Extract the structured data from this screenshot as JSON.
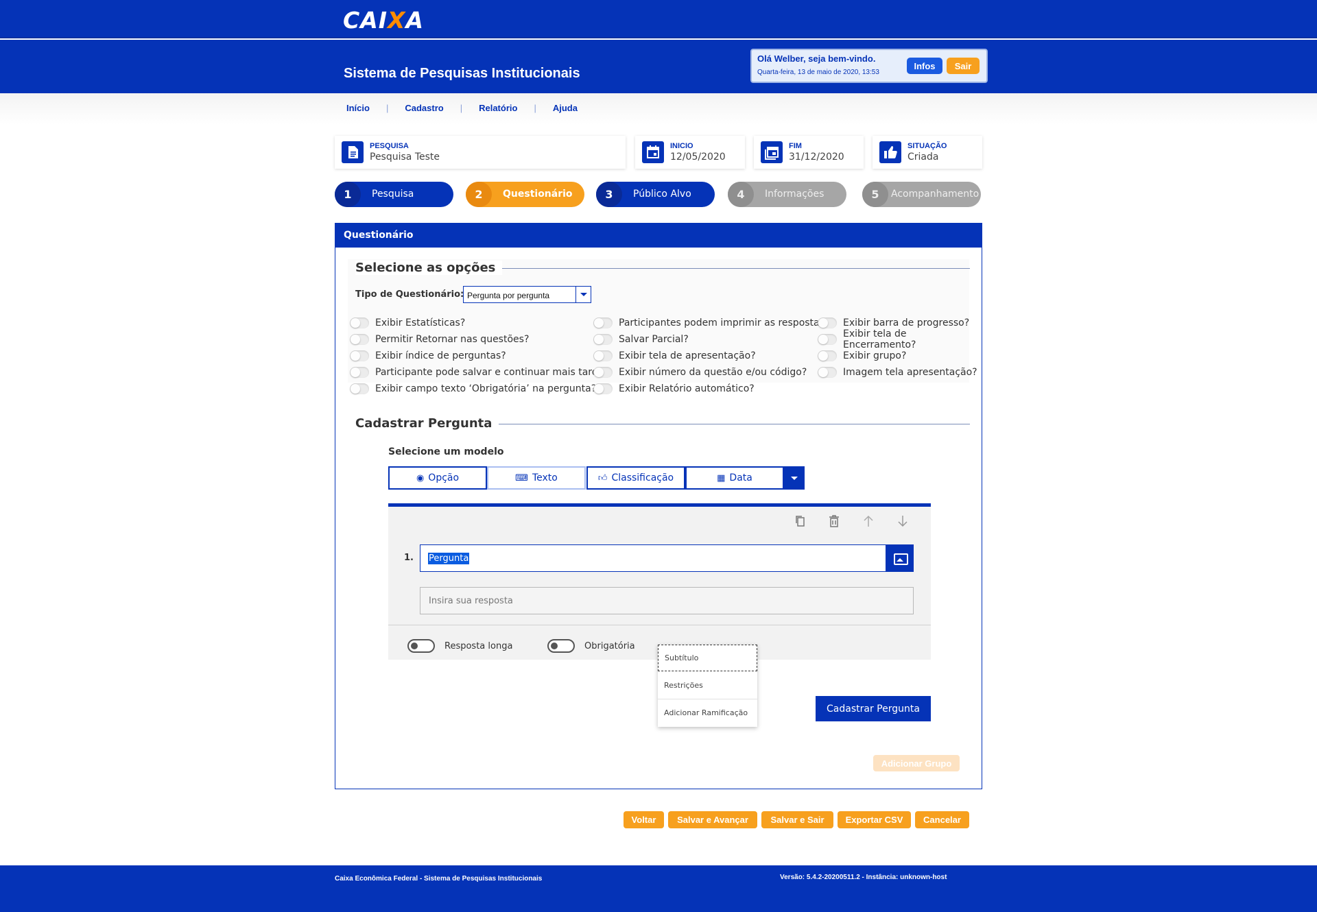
{
  "header": {
    "logo_main": "CAI",
    "logo_x": "X",
    "logo_end": "A",
    "system_title": "Sistema de Pesquisas Institucionais",
    "welcome": "Olá Welber, seja bem-vindo.",
    "datetime": "Quarta-feira, 13 de maio de 2020, 13:53",
    "infos_label": "Infos",
    "sair_label": "Sair"
  },
  "nav": {
    "items": [
      "Início",
      "Cadastro",
      "Relatório",
      "Ajuda"
    ],
    "separator": "|"
  },
  "info_cards": {
    "pesquisa": {
      "label": "PESQUISA",
      "value": "Pesquisa Teste",
      "icon": "document-icon"
    },
    "inicio": {
      "label": "INICIO",
      "value": "12/05/2020",
      "icon": "calendar-icon"
    },
    "fim": {
      "label": "FIM",
      "value": "31/12/2020",
      "icon": "calendar-range-icon"
    },
    "situacao": {
      "label": "SITUAÇÃO",
      "value": "Criada",
      "icon": "thumbs-up-icon"
    }
  },
  "steps": [
    {
      "num": "1",
      "label": "Pesquisa",
      "state": "done"
    },
    {
      "num": "2",
      "label": "Questionário",
      "state": "active"
    },
    {
      "num": "3",
      "label": "Público Alvo",
      "state": "done"
    },
    {
      "num": "4",
      "label": "Informações",
      "state": "disabled"
    },
    {
      "num": "5",
      "label": "Acompanhamento",
      "state": "disabled"
    }
  ],
  "panel": {
    "title": "Questionário",
    "section_options": "Selecione as opções",
    "tipo_label": "Tipo de Questionário:",
    "tipo_value": "Pergunta por pergunta",
    "options_col1": [
      "Exibir Estatísticas?",
      "Permitir Retornar nas questões?",
      "Exibir índice de perguntas?",
      "Participante pode salvar e continuar mais tarde?",
      "Exibir campo texto ‘Obrigatória’ na pergunta?"
    ],
    "options_col2": [
      "Participantes podem imprimir as respostas?",
      "Salvar Parcial?",
      "Exibir tela de apresentação?",
      "Exibir número da questão e/ou código?",
      "Exibir  Relatório automático?"
    ],
    "options_col3": [
      "Exibir barra de progresso?",
      "Exibir tela de Encerramento?",
      "Exibir grupo?",
      "Imagem tela apresentação?"
    ],
    "section_cadastrar": "Cadastrar Pergunta",
    "modelo_label": "Selecione um modelo",
    "models": {
      "opcao": "Opção",
      "texto": "Texto",
      "classificacao": "Classificação",
      "data": "Data"
    },
    "question": {
      "number": "1.",
      "text": "Pergunta",
      "answer_placeholder": "Insira sua resposta",
      "toggle_long": "Resposta longa",
      "toggle_required": "Obrigatória"
    },
    "menu": [
      "Subtítulo",
      "Restrições",
      "Adicionar Ramificação"
    ],
    "cadastrar_button": "Cadastrar Pergunta",
    "adicionar_grupo": "Adicionar Grupo"
  },
  "actions": [
    "Voltar",
    "Salvar e Avançar",
    "Salvar e Sair",
    "Exportar CSV",
    "Cancelar"
  ],
  "footer": {
    "left": "Caixa Econômica Federal - Sistema de Pesquisas Institucionais",
    "right": "Versão: 5.4.2-20200511.2 - Instância: unknown-host"
  },
  "colors": {
    "primary": "#0533b7",
    "accent": "#f7a01e",
    "disabled": "#a6a6a6"
  }
}
